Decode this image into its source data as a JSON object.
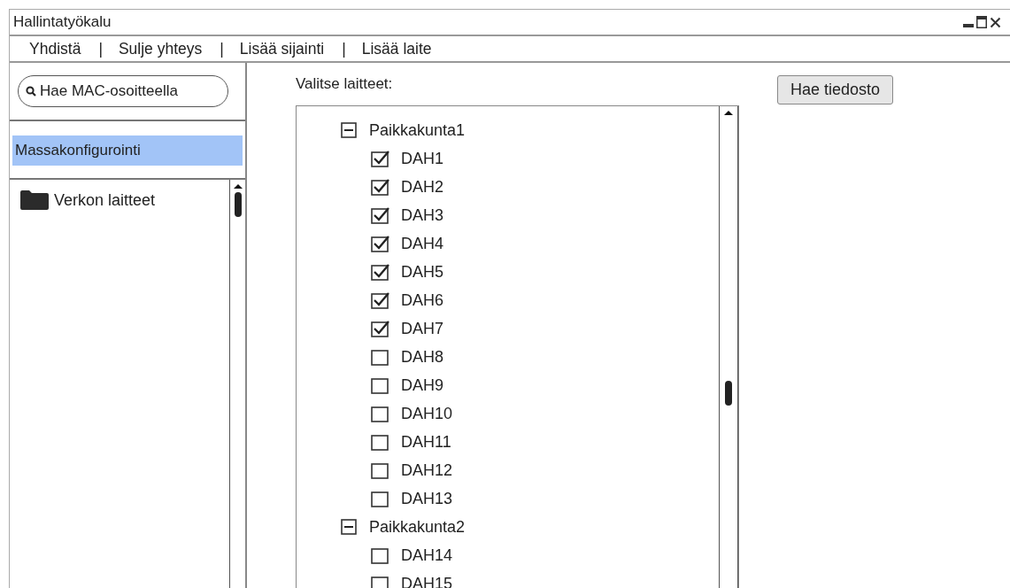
{
  "window": {
    "title": "Hallintatyökalu"
  },
  "menu": [
    "Yhdistä",
    "Sulje yhteys",
    "Lisää sijainti",
    "Lisää laite"
  ],
  "menu_separator": "|",
  "sidebar": {
    "search": {
      "placeholder": "Hae MAC-osoitteella"
    },
    "items": [
      {
        "label": "Massakonfigurointi",
        "selected": true
      }
    ],
    "tree": [
      {
        "label": "Verkon laitteet"
      }
    ]
  },
  "main": {
    "label": "Valitse laitteet:",
    "button": "Hae tiedosto",
    "tree": [
      {
        "label": "Paikkakunta1",
        "expanded": true,
        "children": [
          {
            "label": "DAH1",
            "checked": true
          },
          {
            "label": "DAH2",
            "checked": true
          },
          {
            "label": "DAH3",
            "checked": true
          },
          {
            "label": "DAH4",
            "checked": true
          },
          {
            "label": "DAH5",
            "checked": true
          },
          {
            "label": "DAH6",
            "checked": true
          },
          {
            "label": "DAH7",
            "checked": true
          },
          {
            "label": "DAH8",
            "checked": false
          },
          {
            "label": "DAH9",
            "checked": false
          },
          {
            "label": "DAH10",
            "checked": false
          },
          {
            "label": "DAH11",
            "checked": false
          },
          {
            "label": "DAH12",
            "checked": false
          },
          {
            "label": "DAH13",
            "checked": false
          }
        ]
      },
      {
        "label": "Paikkakunta2",
        "expanded": true,
        "children": [
          {
            "label": "DAH14",
            "checked": false
          },
          {
            "label": "DAH15",
            "checked": false
          }
        ]
      }
    ]
  }
}
